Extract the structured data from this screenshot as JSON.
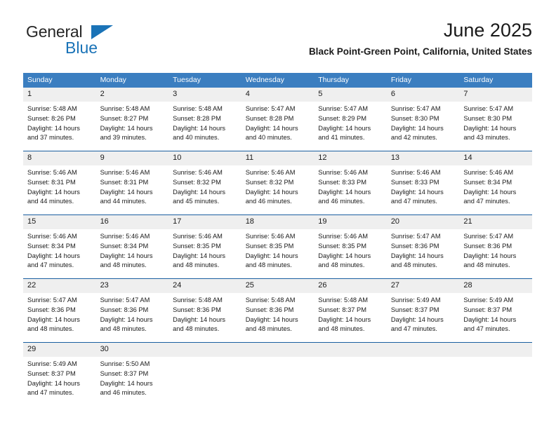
{
  "logo": {
    "word_one": "General",
    "word_two": "Blue",
    "triangle_icon": "blue-triangle-icon",
    "brand_color": "#1a73b7"
  },
  "header": {
    "title": "June 2025",
    "subtitle": "Black Point-Green Point, California, United States"
  },
  "theme": {
    "header_row_bg": "#3b7ec0",
    "week_separator": "#1a5fa0",
    "daynum_bg": "#efefef",
    "text": "#1a1a1a"
  },
  "calendar": {
    "weekday_headers": [
      "Sunday",
      "Monday",
      "Tuesday",
      "Wednesday",
      "Thursday",
      "Friday",
      "Saturday"
    ],
    "weeks": [
      [
        {
          "day": "1",
          "sunrise": "Sunrise: 5:48 AM",
          "sunset": "Sunset: 8:26 PM",
          "daylight_line1": "Daylight: 14 hours",
          "daylight_line2": "and 37 minutes."
        },
        {
          "day": "2",
          "sunrise": "Sunrise: 5:48 AM",
          "sunset": "Sunset: 8:27 PM",
          "daylight_line1": "Daylight: 14 hours",
          "daylight_line2": "and 39 minutes."
        },
        {
          "day": "3",
          "sunrise": "Sunrise: 5:48 AM",
          "sunset": "Sunset: 8:28 PM",
          "daylight_line1": "Daylight: 14 hours",
          "daylight_line2": "and 40 minutes."
        },
        {
          "day": "4",
          "sunrise": "Sunrise: 5:47 AM",
          "sunset": "Sunset: 8:28 PM",
          "daylight_line1": "Daylight: 14 hours",
          "daylight_line2": "and 40 minutes."
        },
        {
          "day": "5",
          "sunrise": "Sunrise: 5:47 AM",
          "sunset": "Sunset: 8:29 PM",
          "daylight_line1": "Daylight: 14 hours",
          "daylight_line2": "and 41 minutes."
        },
        {
          "day": "6",
          "sunrise": "Sunrise: 5:47 AM",
          "sunset": "Sunset: 8:30 PM",
          "daylight_line1": "Daylight: 14 hours",
          "daylight_line2": "and 42 minutes."
        },
        {
          "day": "7",
          "sunrise": "Sunrise: 5:47 AM",
          "sunset": "Sunset: 8:30 PM",
          "daylight_line1": "Daylight: 14 hours",
          "daylight_line2": "and 43 minutes."
        }
      ],
      [
        {
          "day": "8",
          "sunrise": "Sunrise: 5:46 AM",
          "sunset": "Sunset: 8:31 PM",
          "daylight_line1": "Daylight: 14 hours",
          "daylight_line2": "and 44 minutes."
        },
        {
          "day": "9",
          "sunrise": "Sunrise: 5:46 AM",
          "sunset": "Sunset: 8:31 PM",
          "daylight_line1": "Daylight: 14 hours",
          "daylight_line2": "and 44 minutes."
        },
        {
          "day": "10",
          "sunrise": "Sunrise: 5:46 AM",
          "sunset": "Sunset: 8:32 PM",
          "daylight_line1": "Daylight: 14 hours",
          "daylight_line2": "and 45 minutes."
        },
        {
          "day": "11",
          "sunrise": "Sunrise: 5:46 AM",
          "sunset": "Sunset: 8:32 PM",
          "daylight_line1": "Daylight: 14 hours",
          "daylight_line2": "and 46 minutes."
        },
        {
          "day": "12",
          "sunrise": "Sunrise: 5:46 AM",
          "sunset": "Sunset: 8:33 PM",
          "daylight_line1": "Daylight: 14 hours",
          "daylight_line2": "and 46 minutes."
        },
        {
          "day": "13",
          "sunrise": "Sunrise: 5:46 AM",
          "sunset": "Sunset: 8:33 PM",
          "daylight_line1": "Daylight: 14 hours",
          "daylight_line2": "and 47 minutes."
        },
        {
          "day": "14",
          "sunrise": "Sunrise: 5:46 AM",
          "sunset": "Sunset: 8:34 PM",
          "daylight_line1": "Daylight: 14 hours",
          "daylight_line2": "and 47 minutes."
        }
      ],
      [
        {
          "day": "15",
          "sunrise": "Sunrise: 5:46 AM",
          "sunset": "Sunset: 8:34 PM",
          "daylight_line1": "Daylight: 14 hours",
          "daylight_line2": "and 47 minutes."
        },
        {
          "day": "16",
          "sunrise": "Sunrise: 5:46 AM",
          "sunset": "Sunset: 8:34 PM",
          "daylight_line1": "Daylight: 14 hours",
          "daylight_line2": "and 48 minutes."
        },
        {
          "day": "17",
          "sunrise": "Sunrise: 5:46 AM",
          "sunset": "Sunset: 8:35 PM",
          "daylight_line1": "Daylight: 14 hours",
          "daylight_line2": "and 48 minutes."
        },
        {
          "day": "18",
          "sunrise": "Sunrise: 5:46 AM",
          "sunset": "Sunset: 8:35 PM",
          "daylight_line1": "Daylight: 14 hours",
          "daylight_line2": "and 48 minutes."
        },
        {
          "day": "19",
          "sunrise": "Sunrise: 5:46 AM",
          "sunset": "Sunset: 8:35 PM",
          "daylight_line1": "Daylight: 14 hours",
          "daylight_line2": "and 48 minutes."
        },
        {
          "day": "20",
          "sunrise": "Sunrise: 5:47 AM",
          "sunset": "Sunset: 8:36 PM",
          "daylight_line1": "Daylight: 14 hours",
          "daylight_line2": "and 48 minutes."
        },
        {
          "day": "21",
          "sunrise": "Sunrise: 5:47 AM",
          "sunset": "Sunset: 8:36 PM",
          "daylight_line1": "Daylight: 14 hours",
          "daylight_line2": "and 48 minutes."
        }
      ],
      [
        {
          "day": "22",
          "sunrise": "Sunrise: 5:47 AM",
          "sunset": "Sunset: 8:36 PM",
          "daylight_line1": "Daylight: 14 hours",
          "daylight_line2": "and 48 minutes."
        },
        {
          "day": "23",
          "sunrise": "Sunrise: 5:47 AM",
          "sunset": "Sunset: 8:36 PM",
          "daylight_line1": "Daylight: 14 hours",
          "daylight_line2": "and 48 minutes."
        },
        {
          "day": "24",
          "sunrise": "Sunrise: 5:48 AM",
          "sunset": "Sunset: 8:36 PM",
          "daylight_line1": "Daylight: 14 hours",
          "daylight_line2": "and 48 minutes."
        },
        {
          "day": "25",
          "sunrise": "Sunrise: 5:48 AM",
          "sunset": "Sunset: 8:36 PM",
          "daylight_line1": "Daylight: 14 hours",
          "daylight_line2": "and 48 minutes."
        },
        {
          "day": "26",
          "sunrise": "Sunrise: 5:48 AM",
          "sunset": "Sunset: 8:37 PM",
          "daylight_line1": "Daylight: 14 hours",
          "daylight_line2": "and 48 minutes."
        },
        {
          "day": "27",
          "sunrise": "Sunrise: 5:49 AM",
          "sunset": "Sunset: 8:37 PM",
          "daylight_line1": "Daylight: 14 hours",
          "daylight_line2": "and 47 minutes."
        },
        {
          "day": "28",
          "sunrise": "Sunrise: 5:49 AM",
          "sunset": "Sunset: 8:37 PM",
          "daylight_line1": "Daylight: 14 hours",
          "daylight_line2": "and 47 minutes."
        }
      ],
      [
        {
          "day": "29",
          "sunrise": "Sunrise: 5:49 AM",
          "sunset": "Sunset: 8:37 PM",
          "daylight_line1": "Daylight: 14 hours",
          "daylight_line2": "and 47 minutes."
        },
        {
          "day": "30",
          "sunrise": "Sunrise: 5:50 AM",
          "sunset": "Sunset: 8:37 PM",
          "daylight_line1": "Daylight: 14 hours",
          "daylight_line2": "and 46 minutes."
        },
        {
          "day": "",
          "sunrise": "",
          "sunset": "",
          "daylight_line1": "",
          "daylight_line2": ""
        },
        {
          "day": "",
          "sunrise": "",
          "sunset": "",
          "daylight_line1": "",
          "daylight_line2": ""
        },
        {
          "day": "",
          "sunrise": "",
          "sunset": "",
          "daylight_line1": "",
          "daylight_line2": ""
        },
        {
          "day": "",
          "sunrise": "",
          "sunset": "",
          "daylight_line1": "",
          "daylight_line2": ""
        },
        {
          "day": "",
          "sunrise": "",
          "sunset": "",
          "daylight_line1": "",
          "daylight_line2": ""
        }
      ]
    ]
  }
}
